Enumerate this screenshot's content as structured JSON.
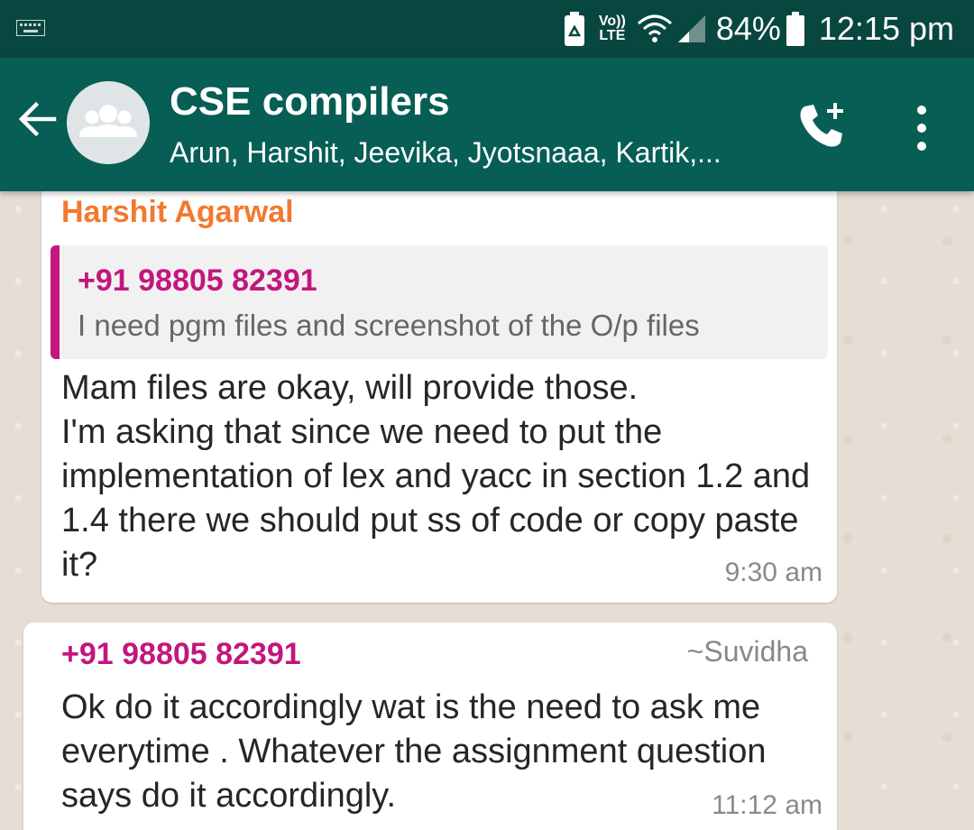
{
  "status_bar": {
    "battery": "84%",
    "time": "12:15 pm",
    "icons": [
      "keyboard-icon",
      "recycle-battery-icon",
      "volte-icon",
      "wifi-icon",
      "signal-icon",
      "battery-icon"
    ],
    "volte_top": "Vo))",
    "volte_bottom": "LTE"
  },
  "header": {
    "title": "CSE compilers",
    "members": "Arun, Harshit, Jeevika, Jyotsnaaa, Kartik,...",
    "colors": {
      "bar": "#075e54",
      "status": "#07473f"
    }
  },
  "messages": [
    {
      "sender": "Harshit Agarwal",
      "sender_color": "#f4782f",
      "quote": {
        "author": "+91 98805 82391",
        "text": "I need pgm files and screenshot of the O/p files"
      },
      "text": "Mam files are okay, will provide those.\nI'm asking that since we need to put the implementation of lex and yacc in section 1.2 and 1.4 there we should put ss of code or copy paste it?",
      "time": "9:30 am"
    },
    {
      "sender": "+91 98805 82391",
      "nickname": "~Suvidha",
      "sender_color": "#c3167f",
      "text": "Ok do it accordingly wat is the need to ask me everytime  . Whatever the assignment question says do it accordingly.",
      "time": "11:12 am"
    }
  ]
}
